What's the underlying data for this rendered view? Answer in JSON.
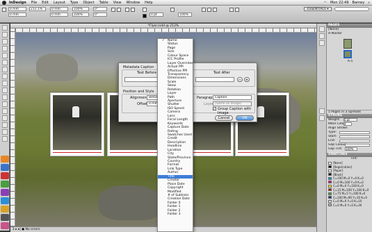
{
  "menubar": {
    "app": "InDesign",
    "items": [
      "File",
      "Edit",
      "Layout",
      "Type",
      "Object",
      "Table",
      "View",
      "Window",
      "Help"
    ],
    "clock": "Mon 22:49",
    "user": "Barney"
  },
  "control": {
    "x_value": "0 mm",
    "zoom": "212.1%",
    "workspace": "ESSENTIALS ▾",
    "field_a": "100%",
    "field_b": "100%",
    "field_c": "0°",
    "field_d": "0°"
  },
  "document": {
    "title": "*Flyer.indd @ 212%"
  },
  "status": {
    "text": "1  ▸ ▸|  ● No errors"
  },
  "dialog": {
    "section_caption": "Metadata Caption",
    "text_before": "Text Before",
    "text_after": "Text After",
    "section_position": "Position and Style",
    "alignment_label": "Alignment:",
    "alignment_value": "Below Image",
    "offset_label": "Offset:",
    "offset_value": "0 mm",
    "para_style_label": "Paragraph Style:",
    "para_style_value": "Caption",
    "layer_label": "Layer:",
    "layer_value": "[Same as Image]",
    "group_caption": "Group Caption with Image",
    "cancel": "Cancel",
    "ok": "OK"
  },
  "dropdown": {
    "checked_item": "Name",
    "selected_item": "Title",
    "items": [
      "Name",
      "Status",
      "Page",
      "Size",
      "Colour Space",
      "ICC Profile",
      "Layer Overrides",
      "Actual PPI",
      "Effective PPI",
      "Transparency",
      "Dimensions",
      "Scale",
      "Skew",
      "Rotation",
      "Layer",
      "Path",
      "Aperture",
      "Shutter",
      "ISO Speed",
      "Camera",
      "Lens",
      "Focal Length",
      "Keywords",
      "Capture Date",
      "Rating",
      "Swatches Used",
      "Credit",
      "Description",
      "Headline",
      "Location",
      "City",
      "State/Province",
      "Country",
      "Format",
      "Link Type",
      "Author",
      "Title",
      "Creator",
      "Place Date",
      "Copyright",
      "Modified",
      "# of Sublinks",
      "Creation Date",
      "Folder 0",
      "Folder 1",
      "Folder 2",
      "Folder 3"
    ]
  },
  "panels": {
    "pages_title": "PAGES",
    "none_label": "[None]",
    "a_master": "A-Master",
    "page_label": "A-5",
    "pages_footer": "5 Pages in 3 Spreads",
    "stroke_title": "STROKE",
    "weight_label": "Weight:",
    "weight_value": "0 pt",
    "miter_label": "Miter Limit:",
    "miter_value": "4",
    "align_stroke": "Align Stroke:",
    "type_label": "Type:",
    "start_label": "Start:",
    "end_label": "End:",
    "gap_color": "Gap Colour:",
    "gap_tint": "Gap Tint:",
    "gap_tint_value": "100%",
    "swatches_title": "SWATCHES",
    "tint_label": "Tint:",
    "swatches": [
      {
        "name": "[None]",
        "color": "#ffffff"
      },
      {
        "name": "[Registration]",
        "color": "#000000"
      },
      {
        "name": "[Paper]",
        "color": "#ffffff"
      },
      {
        "name": "[Black]",
        "color": "#000000"
      },
      {
        "name": "C=100 M=0 Y=0 K=0",
        "color": "#00a0e9"
      },
      {
        "name": "C=0 M=100 Y=0 K=0",
        "color": "#e4007f"
      },
      {
        "name": "C=0 M=0 Y=100 K=0",
        "color": "#fff100"
      },
      {
        "name": "C=15 M=100 Y=100 K=0",
        "color": "#c8161d"
      },
      {
        "name": "C=75 M=5 Y=100 K=0",
        "color": "#3aa935"
      },
      {
        "name": "C=100 M=90 Y=10 K=0",
        "color": "#23318c"
      },
      {
        "name": "C=0 M=0 Y=0 K=10",
        "color": "#e6e6e6"
      },
      {
        "name": "C=0 M=0 Y=0 K=30",
        "color": "#b5b5b5"
      }
    ]
  }
}
